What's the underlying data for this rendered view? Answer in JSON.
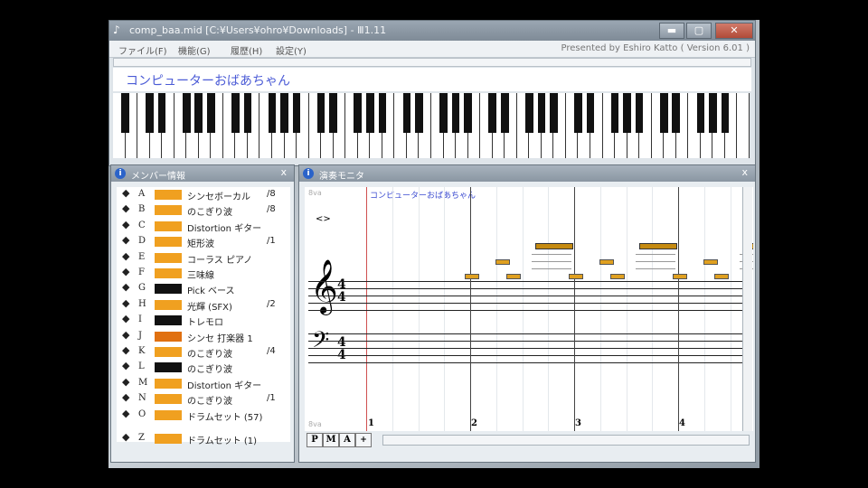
{
  "window": {
    "title": "comp_baa.mid [C:¥Users¥ohro¥Downloads] - Ⅲ1.11",
    "menu": [
      "ファイル(F)",
      "機能(G)",
      "履歴(H)",
      "設定(Y)"
    ],
    "presented_by": "Presented by Eshiro Katto ( Version 6.01 )",
    "song_title": "コンピューターおばあちゃん",
    "controls": {
      "minimize": "▬",
      "maximize": "▢",
      "close": "✕"
    }
  },
  "member_panel": {
    "title": "メンバー情報",
    "close": "x",
    "members": [
      {
        "letter": "A",
        "color": "#f0a020",
        "name": "シンセボーカル",
        "ch": "/8"
      },
      {
        "letter": "B",
        "color": "#f0a020",
        "name": "のこぎり波",
        "ch": "/8"
      },
      {
        "letter": "C",
        "color": "#f0a020",
        "name": "Distortion ギター",
        "ch": ""
      },
      {
        "letter": "D",
        "color": "#f0a020",
        "name": "矩形波",
        "ch": "/1"
      },
      {
        "letter": "E",
        "color": "#f0a020",
        "name": "コーラス ピアノ",
        "ch": ""
      },
      {
        "letter": "F",
        "color": "#f0a020",
        "name": "三味線",
        "ch": ""
      },
      {
        "letter": "G",
        "color": "#111111",
        "name": "Pick ベース",
        "ch": ""
      },
      {
        "letter": "H",
        "color": "#f0a020",
        "name": "光輝 (SFX)",
        "ch": "/2"
      },
      {
        "letter": "I",
        "color": "#111111",
        "name": "トレモロ",
        "ch": ""
      },
      {
        "letter": "J",
        "color": "#e07010",
        "name": "シンセ 打楽器 1",
        "ch": ""
      },
      {
        "letter": "K",
        "color": "#f0a020",
        "name": "のこぎり波",
        "ch": "/4"
      },
      {
        "letter": "L",
        "color": "#111111",
        "name": "のこぎり波",
        "ch": ""
      },
      {
        "letter": "M",
        "color": "#f0a020",
        "name": "Distortion ギター",
        "ch": ""
      },
      {
        "letter": "N",
        "color": "#f0a020",
        "name": "のこぎり波",
        "ch": "/1"
      },
      {
        "letter": "O",
        "color": "#f0a020",
        "name": "ドラムセット (57)",
        "ch": ""
      },
      {
        "letter": "Z",
        "color": "#f0a020",
        "name": "ドラムセット (1)",
        "ch": ""
      }
    ]
  },
  "monitor_panel": {
    "title": "演奏モニタ",
    "close": "x",
    "score_title": "コンピューターおばあちゃん",
    "top_mark": "8va",
    "bottom_mark": "8va",
    "repeat_mark": "<>",
    "time_sig": {
      "treble_top": "4",
      "treble_bottom": "4",
      "bass_top": "4",
      "bass_bottom": "4"
    },
    "measures": [
      "1",
      "2",
      "3",
      "4"
    ],
    "tabs": [
      "P",
      "M",
      "A"
    ],
    "tab_arrow": "+"
  }
}
